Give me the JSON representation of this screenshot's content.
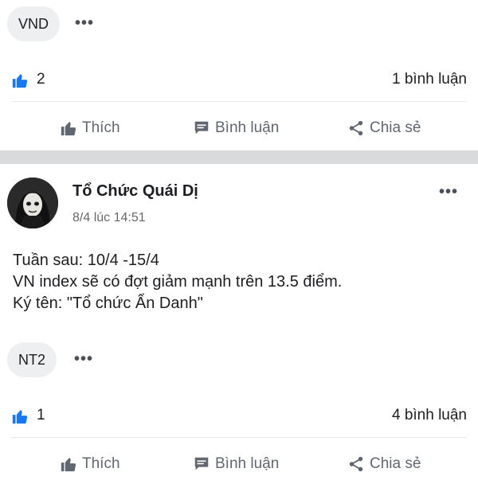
{
  "post1": {
    "chip_label": "VND",
    "likes": "2",
    "comments": "1 bình luận",
    "actions": {
      "like": "Thích",
      "comment": "Bình luận",
      "share": "Chia sẻ"
    }
  },
  "post2": {
    "author": "Tổ Chức Quái Dị",
    "time": "8/4 lúc 14:51",
    "body": [
      "Tuần sau: 10/4 -15/4",
      "VN index sẽ có đợt giảm mạnh trên 13.5 điểm.",
      "Ký tên: \"Tổ chức Ẩn Danh\""
    ],
    "chip_label": "NT2",
    "likes": "1",
    "comments": "4 bình luận",
    "actions": {
      "like": "Thích",
      "comment": "Bình luận",
      "share": "Chia sẻ"
    }
  },
  "colors": {
    "like_blue": "#1877f2",
    "action_gray": "#606770",
    "band_gray": "#d9dadc"
  },
  "icons": [
    "like-icon",
    "comment-icon",
    "share-icon",
    "more-options-icon"
  ]
}
